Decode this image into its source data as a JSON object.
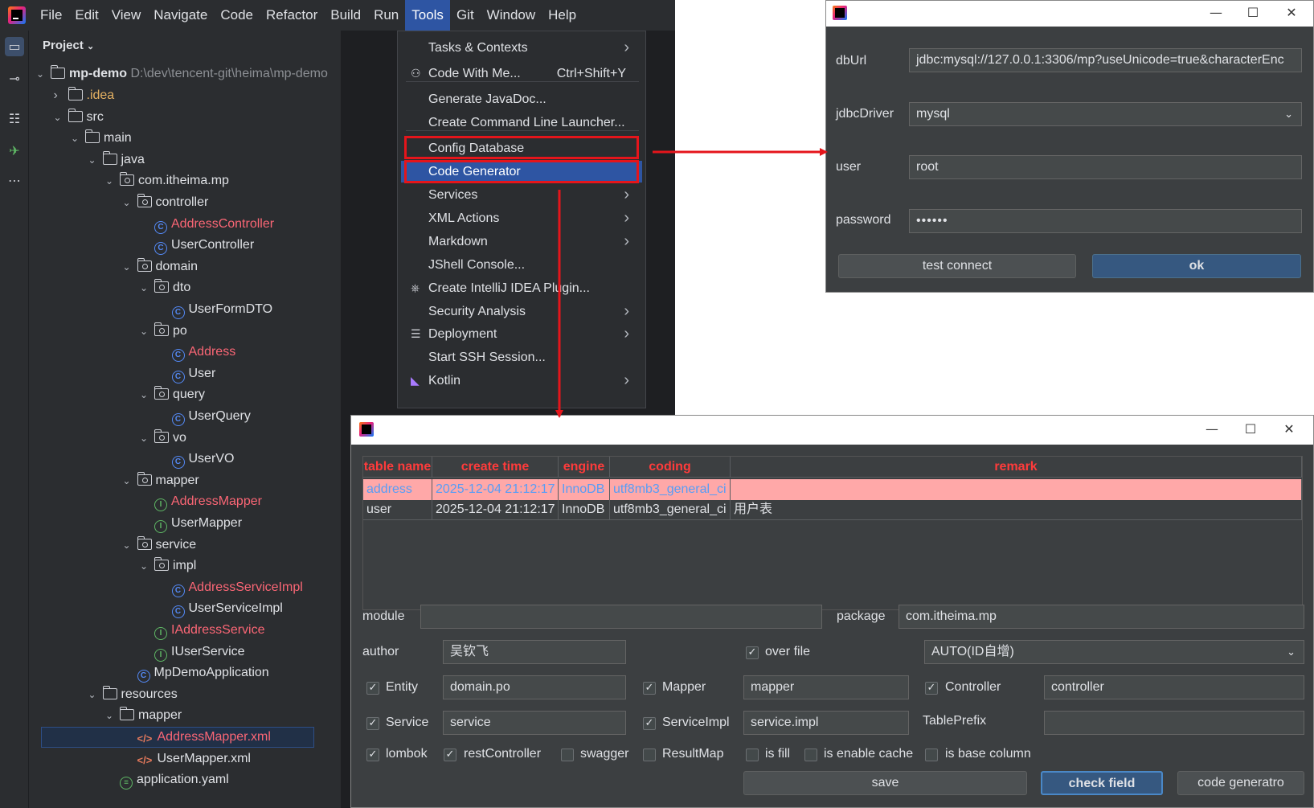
{
  "menubar": {
    "items": [
      "File",
      "Edit",
      "View",
      "Navigate",
      "Code",
      "Refactor",
      "Build",
      "Run",
      "Tools",
      "Git",
      "Window",
      "Help"
    ],
    "active": "Tools"
  },
  "project": {
    "title": "Project",
    "root_name": "mp-demo",
    "root_path": "D:\\dev\\tencent-git\\heima\\mp-demo",
    "tree": [
      {
        "label": ".idea",
        "depth": 1,
        "expanded": false,
        "icon": "folder-icon",
        "color": "orange"
      },
      {
        "label": "src",
        "depth": 1,
        "expanded": true,
        "icon": "folder-icon",
        "color": ""
      },
      {
        "label": "main",
        "depth": 2,
        "expanded": true,
        "icon": "folder-icon",
        "color": ""
      },
      {
        "label": "java",
        "depth": 3,
        "expanded": true,
        "icon": "folder-icon",
        "color": ""
      },
      {
        "label": "com.itheima.mp",
        "depth": 4,
        "expanded": true,
        "icon": "package-icon",
        "color": ""
      },
      {
        "label": "controller",
        "depth": 5,
        "expanded": true,
        "icon": "package-icon",
        "color": ""
      },
      {
        "label": "AddressController",
        "depth": 6,
        "icon": "class-icon",
        "color": "red"
      },
      {
        "label": "UserController",
        "depth": 6,
        "icon": "class-icon",
        "color": ""
      },
      {
        "label": "domain",
        "depth": 5,
        "expanded": true,
        "icon": "package-icon",
        "color": ""
      },
      {
        "label": "dto",
        "depth": 6,
        "expanded": true,
        "icon": "package-icon",
        "color": ""
      },
      {
        "label": "UserFormDTO",
        "depth": 7,
        "icon": "class-icon",
        "color": ""
      },
      {
        "label": "po",
        "depth": 6,
        "expanded": true,
        "icon": "package-icon",
        "color": ""
      },
      {
        "label": "Address",
        "depth": 7,
        "icon": "class-icon",
        "color": "red"
      },
      {
        "label": "User",
        "depth": 7,
        "icon": "class-icon",
        "color": ""
      },
      {
        "label": "query",
        "depth": 6,
        "expanded": true,
        "icon": "package-icon",
        "color": ""
      },
      {
        "label": "UserQuery",
        "depth": 7,
        "icon": "class-icon",
        "color": ""
      },
      {
        "label": "vo",
        "depth": 6,
        "expanded": true,
        "icon": "package-icon",
        "color": ""
      },
      {
        "label": "UserVO",
        "depth": 7,
        "icon": "class-icon",
        "color": ""
      },
      {
        "label": "mapper",
        "depth": 5,
        "expanded": true,
        "icon": "package-icon",
        "color": ""
      },
      {
        "label": "AddressMapper",
        "depth": 6,
        "icon": "interface-icon",
        "color": "red"
      },
      {
        "label": "UserMapper",
        "depth": 6,
        "icon": "interface-icon",
        "color": ""
      },
      {
        "label": "service",
        "depth": 5,
        "expanded": true,
        "icon": "package-icon",
        "color": ""
      },
      {
        "label": "impl",
        "depth": 6,
        "expanded": true,
        "icon": "package-icon",
        "color": ""
      },
      {
        "label": "AddressServiceImpl",
        "depth": 7,
        "icon": "class-icon",
        "color": "red"
      },
      {
        "label": "UserServiceImpl",
        "depth": 7,
        "icon": "class-icon",
        "color": ""
      },
      {
        "label": "IAddressService",
        "depth": 6,
        "icon": "interface-icon",
        "color": "red"
      },
      {
        "label": "IUserService",
        "depth": 6,
        "icon": "interface-icon",
        "color": ""
      },
      {
        "label": "MpDemoApplication",
        "depth": 5,
        "icon": "app-class-icon",
        "color": ""
      },
      {
        "label": "resources",
        "depth": 3,
        "expanded": true,
        "icon": "folder-icon",
        "color": ""
      },
      {
        "label": "mapper",
        "depth": 4,
        "expanded": true,
        "icon": "folder-icon",
        "color": ""
      },
      {
        "label": "AddressMapper.xml",
        "depth": 5,
        "icon": "xml-icon",
        "color": "red",
        "selected": true
      },
      {
        "label": "UserMapper.xml",
        "depth": 5,
        "icon": "xml-icon",
        "color": ""
      },
      {
        "label": "application.yaml",
        "depth": 4,
        "icon": "yaml-icon",
        "color": ""
      }
    ]
  },
  "tools_menu": {
    "items": [
      {
        "label": "Tasks & Contexts",
        "shortcut": "",
        "submenu": true,
        "icon": ""
      },
      {
        "label": "Code With Me...",
        "shortcut": "Ctrl+Shift+Y",
        "submenu": false,
        "icon": "person-icon"
      },
      {
        "label": "Generate JavaDoc...",
        "shortcut": "",
        "submenu": false,
        "icon": ""
      },
      {
        "label": "Create Command Line Launcher...",
        "shortcut": "",
        "submenu": false,
        "icon": ""
      },
      {
        "label": "Config Database",
        "shortcut": "",
        "submenu": false,
        "icon": ""
      },
      {
        "label": "Code Generator",
        "shortcut": "",
        "submenu": false,
        "icon": "",
        "highlighted": true
      },
      {
        "label": "Services",
        "shortcut": "",
        "submenu": true,
        "icon": ""
      },
      {
        "label": "XML Actions",
        "shortcut": "",
        "submenu": true,
        "icon": ""
      },
      {
        "label": "Markdown",
        "shortcut": "",
        "submenu": true,
        "icon": ""
      },
      {
        "label": "JShell Console...",
        "shortcut": "",
        "submenu": false,
        "icon": ""
      },
      {
        "label": "Create IntelliJ IDEA Plugin...",
        "shortcut": "",
        "submenu": false,
        "icon": "plugin-icon"
      },
      {
        "label": "Security Analysis",
        "shortcut": "",
        "submenu": true,
        "icon": ""
      },
      {
        "label": "Deployment",
        "shortcut": "",
        "submenu": true,
        "icon": "server-icon"
      },
      {
        "label": "Start SSH Session...",
        "shortcut": "",
        "submenu": false,
        "icon": ""
      },
      {
        "label": "Kotlin",
        "shortcut": "",
        "submenu": true,
        "icon": "kotlin-icon"
      }
    ]
  },
  "db_dialog": {
    "dburl_label": "dbUrl",
    "dburl_value": "jdbc:mysql://127.0.0.1:3306/mp?useUnicode=true&characterEnc",
    "driver_label": "jdbcDriver",
    "driver_value": "mysql",
    "user_label": "user",
    "user_value": "root",
    "password_label": "password",
    "password_value": "••••••",
    "test_button": "test connect",
    "ok_button": "ok"
  },
  "gen_dialog": {
    "table": {
      "columns": [
        "table name",
        "create time",
        "engine",
        "coding",
        "remark"
      ],
      "rows": [
        [
          "address",
          "2025-12-04 21:12:17",
          "InnoDB",
          "utf8mb3_general_ci",
          ""
        ],
        [
          "user",
          "2025-12-04 21:12:17",
          "InnoDB",
          "utf8mb3_general_ci",
          "用户表"
        ]
      ]
    },
    "module_label": "module",
    "module_value": "",
    "package_label": "package",
    "package_value": "com.itheima.mp",
    "author_label": "author",
    "author_value": "吴钦飞",
    "overfile_label": "over file",
    "idtype_value": "AUTO(ID自增)",
    "entity_label": "Entity",
    "entity_value": "domain.po",
    "mapper_label": "Mapper",
    "mapper_value": "mapper",
    "controller_label": "Controller",
    "controller_value": "controller",
    "service_label": "Service",
    "service_value": "service",
    "serviceimpl_label": "ServiceImpl",
    "serviceimpl_value": "service.impl",
    "tableprefix_label": "TablePrefix",
    "tableprefix_value": "",
    "lombok_label": "lombok",
    "restcontroller_label": "restController",
    "swagger_label": "swagger",
    "resultmap_label": "ResultMap",
    "isfill_label": "is fill",
    "cache_label": "is enable cache",
    "basecolumn_label": "is base column",
    "save_button": "save",
    "check_button": "check field",
    "generate_button": "code generatro",
    "check_mark": "✓"
  },
  "colors": {
    "accent_blue": "#2e55a3",
    "highlight_red": "#e5151b",
    "selected_row": "#ffa8a8",
    "modified_file": "#fa6675"
  }
}
